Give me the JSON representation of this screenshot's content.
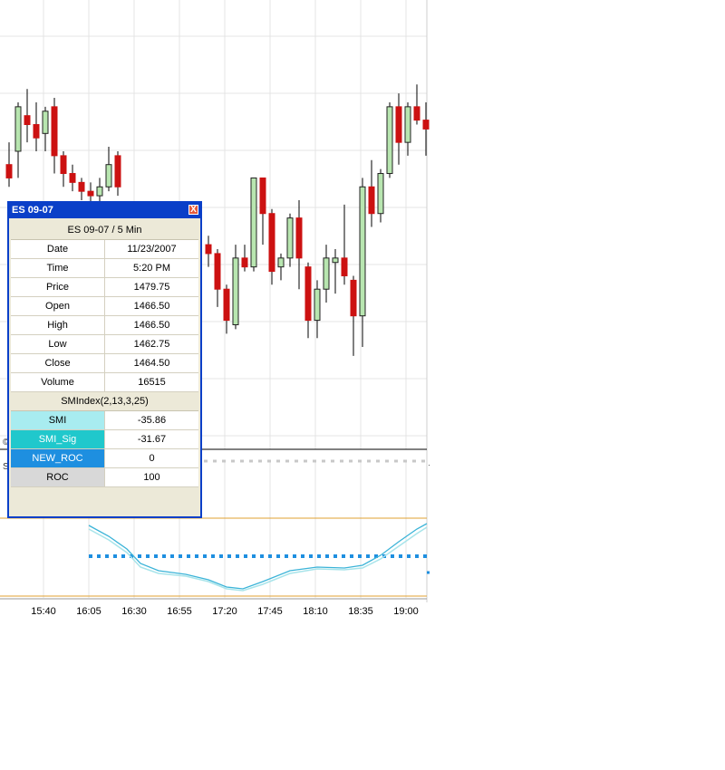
{
  "chart_data": {
    "type": "candlestick",
    "symbol": "ES 09-07",
    "x_tick_labels": [
      "15:40",
      "16:05",
      "16:30",
      "16:55",
      "17:20",
      "17:45",
      "18:10",
      "18:35",
      "19:00"
    ],
    "candles": [
      {
        "o": 1467.25,
        "h": 1468.5,
        "l": 1466.0,
        "c": 1466.5
      },
      {
        "o": 1468.0,
        "h": 1470.75,
        "l": 1466.5,
        "c": 1470.5
      },
      {
        "o": 1470.0,
        "h": 1471.5,
        "l": 1468.5,
        "c": 1469.5
      },
      {
        "o": 1469.5,
        "h": 1470.75,
        "l": 1468.0,
        "c": 1468.75
      },
      {
        "o": 1469.0,
        "h": 1470.5,
        "l": 1468.0,
        "c": 1470.25
      },
      {
        "o": 1470.5,
        "h": 1471.0,
        "l": 1466.75,
        "c": 1467.75
      },
      {
        "o": 1467.75,
        "h": 1468.0,
        "l": 1466.0,
        "c": 1466.75
      },
      {
        "o": 1466.75,
        "h": 1467.25,
        "l": 1465.75,
        "c": 1466.25
      },
      {
        "o": 1466.25,
        "h": 1466.5,
        "l": 1465.25,
        "c": 1465.75
      },
      {
        "o": 1465.75,
        "h": 1466.25,
        "l": 1465.0,
        "c": 1465.5
      },
      {
        "o": 1465.5,
        "h": 1466.5,
        "l": 1464.75,
        "c": 1466.0
      },
      {
        "o": 1466.0,
        "h": 1468.25,
        "l": 1465.75,
        "c": 1467.25
      },
      {
        "o": 1467.75,
        "h": 1468.0,
        "l": 1465.5,
        "c": 1466.0
      },
      null,
      null,
      null,
      null,
      null,
      null,
      null,
      null,
      null,
      {
        "o": 1462.75,
        "h": 1463.25,
        "l": 1461.5,
        "c": 1462.25
      },
      {
        "o": 1462.25,
        "h": 1462.5,
        "l": 1459.25,
        "c": 1460.25
      },
      {
        "o": 1460.25,
        "h": 1460.5,
        "l": 1457.75,
        "c": 1458.5
      },
      {
        "o": 1458.25,
        "h": 1462.75,
        "l": 1458.0,
        "c": 1462.0
      },
      {
        "o": 1462.0,
        "h": 1462.75,
        "l": 1461.25,
        "c": 1461.5
      },
      {
        "o": 1461.5,
        "h": 1466.5,
        "l": 1461.25,
        "c": 1466.5
      },
      {
        "o": 1466.5,
        "h": 1466.5,
        "l": 1462.75,
        "c": 1464.5
      },
      {
        "o": 1464.5,
        "h": 1464.75,
        "l": 1460.5,
        "c": 1461.25
      },
      {
        "o": 1461.5,
        "h": 1462.25,
        "l": 1460.75,
        "c": 1462.0
      },
      {
        "o": 1462.0,
        "h": 1464.5,
        "l": 1461.5,
        "c": 1464.25
      },
      {
        "o": 1464.25,
        "h": 1465.25,
        "l": 1460.25,
        "c": 1462.0
      },
      {
        "o": 1461.5,
        "h": 1461.75,
        "l": 1457.5,
        "c": 1458.5
      },
      {
        "o": 1458.5,
        "h": 1460.75,
        "l": 1457.5,
        "c": 1460.25
      },
      {
        "o": 1460.25,
        "h": 1462.75,
        "l": 1459.5,
        "c": 1462.0
      },
      {
        "o": 1461.75,
        "h": 1462.5,
        "l": 1460.0,
        "c": 1462.0
      },
      {
        "o": 1462.0,
        "h": 1465.0,
        "l": 1460.5,
        "c": 1461.0
      },
      {
        "o": 1460.75,
        "h": 1461.0,
        "l": 1456.5,
        "c": 1458.75
      },
      {
        "o": 1458.75,
        "h": 1466.5,
        "l": 1457.0,
        "c": 1466.0
      },
      {
        "o": 1466.0,
        "h": 1467.5,
        "l": 1463.75,
        "c": 1464.5
      },
      {
        "o": 1464.5,
        "h": 1467.0,
        "l": 1464.0,
        "c": 1466.75
      },
      {
        "o": 1466.75,
        "h": 1470.75,
        "l": 1466.5,
        "c": 1470.5
      },
      {
        "o": 1470.5,
        "h": 1471.25,
        "l": 1467.25,
        "c": 1468.5
      },
      {
        "o": 1468.5,
        "h": 1470.75,
        "l": 1467.75,
        "c": 1470.5
      },
      {
        "o": 1470.5,
        "h": 1471.75,
        "l": 1469.5,
        "c": 1469.75
      },
      {
        "o": 1469.75,
        "h": 1470.75,
        "l": 1467.75,
        "c": 1469.25
      }
    ],
    "colors": {
      "up": "#b8e6b0",
      "down": "#cc1111",
      "up_border": "#222222",
      "grid": "#e4e4e4",
      "smi": "#3cb4d8",
      "smi_sig": "#a8e4ea",
      "dotted": "#1e8fe0",
      "band": "#e0a030"
    }
  },
  "data_window": {
    "title": "ES 09-07",
    "close_glyph": "X",
    "header": "ES 09-07 / 5 Min",
    "rows": [
      {
        "label": "Date",
        "value": "11/23/2007"
      },
      {
        "label": "Time",
        "value": "5:20 PM"
      },
      {
        "label": "Price",
        "value": "1479.75"
      },
      {
        "label": "Open",
        "value": "1466.50"
      },
      {
        "label": "High",
        "value": "1466.50"
      },
      {
        "label": "Low",
        "value": "1462.75"
      },
      {
        "label": "Close",
        "value": "1464.50"
      },
      {
        "label": "Volume",
        "value": "16515"
      }
    ],
    "indicator_header": "SMIndex(2,13,3,25)",
    "indicator_rows": [
      {
        "label": "SMI",
        "value": "-35.86",
        "color": "#a8ecf0",
        "text_color": "#000000"
      },
      {
        "label": "SMI_Sig",
        "value": "-31.67",
        "color": "#20c8cc",
        "text_color": "#ffffff"
      },
      {
        "label": "NEW_ROC",
        "value": "0",
        "color": "#1e8fe0",
        "text_color": "#ffffff"
      },
      {
        "label": "ROC",
        "value": "100",
        "color": "#d8d8d8",
        "text_color": "#000000"
      }
    ]
  },
  "panel_fragments": {
    "top": "©",
    "bottom": "S"
  }
}
